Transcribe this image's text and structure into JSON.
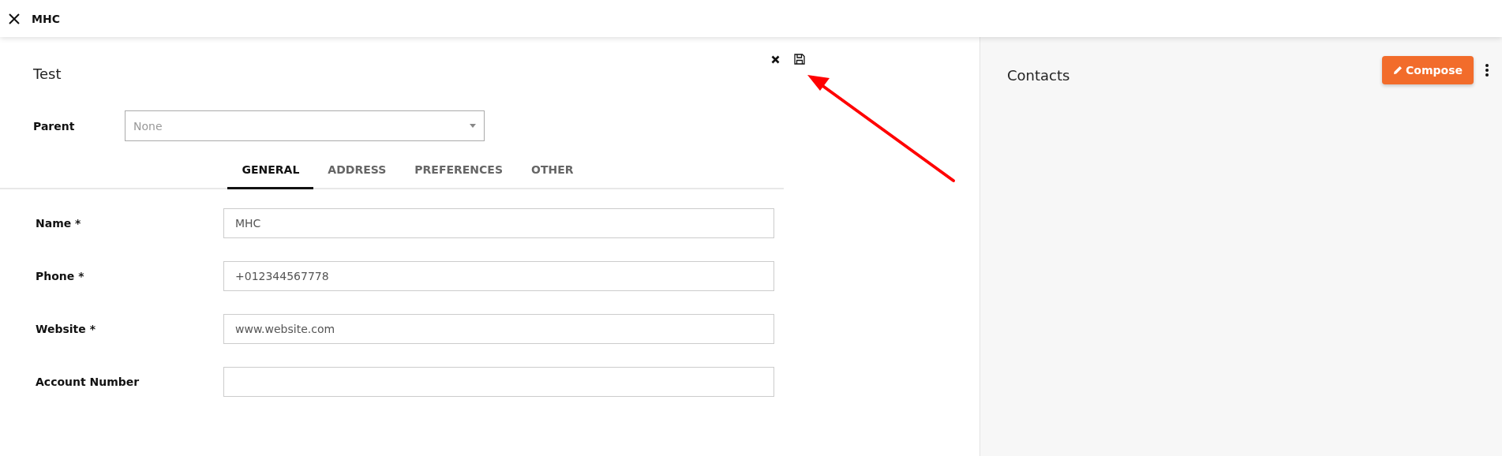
{
  "header": {
    "title": "MHC"
  },
  "form": {
    "title": "Test",
    "parent": {
      "label": "Parent",
      "placeholder": "None"
    },
    "tabs": [
      {
        "label": "GENERAL",
        "selected": true
      },
      {
        "label": "ADDRESS",
        "selected": false
      },
      {
        "label": "PREFERENCES",
        "selected": false
      },
      {
        "label": "OTHER",
        "selected": false
      }
    ],
    "fields": [
      {
        "label": "Name *",
        "value": "MHC"
      },
      {
        "label": "Phone *",
        "value": "+012344567778"
      },
      {
        "label": "Website *",
        "value": "www.website.com"
      },
      {
        "label": "Account Number"
      }
    ]
  },
  "contacts": {
    "title": "Contacts",
    "compose_button": "Compose"
  }
}
